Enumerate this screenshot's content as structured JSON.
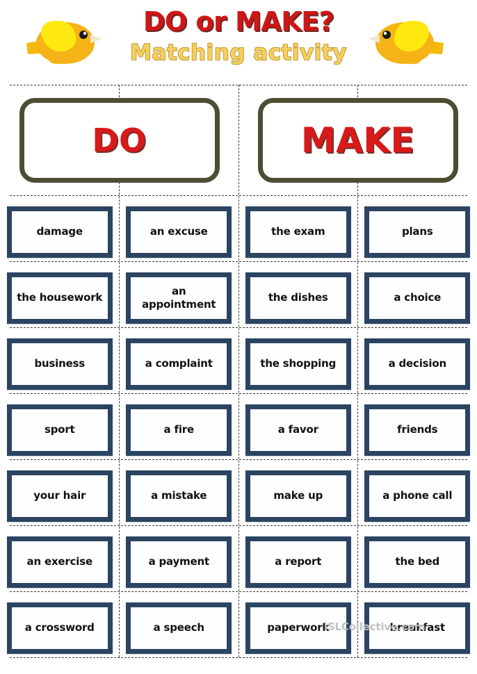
{
  "header": {
    "title": "DO or MAKE?",
    "subtitle": "Matching activity",
    "bird_left_icon": "bird-icon",
    "bird_right_icon": "bird-icon",
    "title_color": "#cf1616",
    "subtitle_color": "#f2cf5e"
  },
  "categories": [
    {
      "label": "DO"
    },
    {
      "label": "MAKE"
    }
  ],
  "category_box": {
    "border_color": "#4d4d33",
    "text_color": "#d81a1a"
  },
  "card_style": {
    "border_color": "#2b4462",
    "background": "#fdfeff",
    "text_color": "#111111"
  },
  "rows": [
    {
      "cells": [
        "damage",
        "an excuse",
        "the exam",
        "plans"
      ]
    },
    {
      "cells": [
        "the\nhousework",
        "an\nappointment",
        "the dishes",
        "a choice"
      ]
    },
    {
      "cells": [
        "business",
        "a complaint",
        "the\nshopping",
        "a decision"
      ]
    },
    {
      "cells": [
        "sport",
        "a fire",
        "a favor",
        "friends"
      ]
    },
    {
      "cells": [
        "your hair",
        "a mistake",
        "make up",
        "a phone call"
      ]
    },
    {
      "cells": [
        "an exercise",
        "a payment",
        "a report",
        "the bed"
      ]
    },
    {
      "cells": [
        "a crossword",
        "a speech",
        "paperwork",
        "breakfast"
      ]
    }
  ],
  "watermark": {
    "text": "iSLCollective.com"
  }
}
